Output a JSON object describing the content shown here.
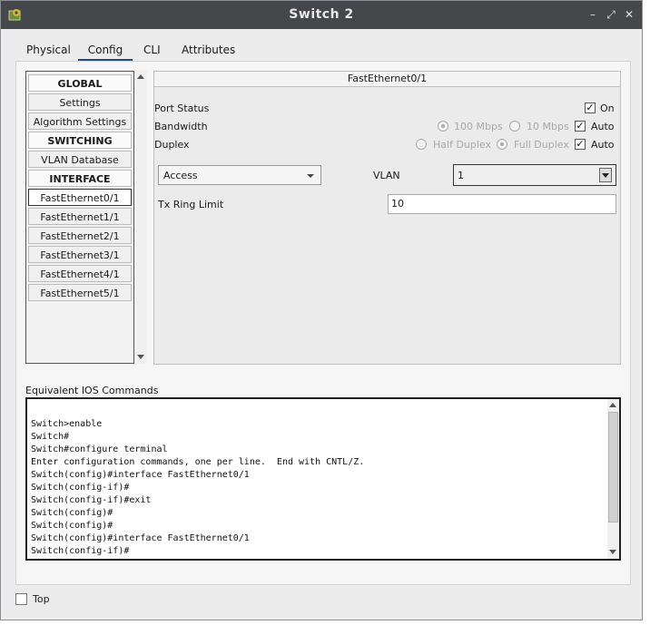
{
  "window": {
    "title": "Switch 2"
  },
  "tabs": [
    {
      "label": "Physical"
    },
    {
      "label": "Config"
    },
    {
      "label": "CLI"
    },
    {
      "label": "Attributes"
    }
  ],
  "sidebar": {
    "items": [
      {
        "label": "GLOBAL"
      },
      {
        "label": "Settings"
      },
      {
        "label": "Algorithm Settings"
      },
      {
        "label": "SWITCHING"
      },
      {
        "label": "VLAN Database"
      },
      {
        "label": "INTERFACE"
      },
      {
        "label": "FastEthernet0/1"
      },
      {
        "label": "FastEthernet1/1"
      },
      {
        "label": "FastEthernet2/1"
      },
      {
        "label": "FastEthernet3/1"
      },
      {
        "label": "FastEthernet4/1"
      },
      {
        "label": "FastEthernet5/1"
      }
    ]
  },
  "interface": {
    "name": "FastEthernet0/1",
    "port_status_label": "Port Status",
    "port_on_label": "On",
    "bandwidth_label": "Bandwidth",
    "bw_100": "100 Mbps",
    "bw_10": "10 Mbps",
    "bw_auto": "Auto",
    "duplex_label": "Duplex",
    "half_duplex": "Half Duplex",
    "full_duplex": "Full Duplex",
    "duplex_auto": "Auto",
    "mode_value": "Access",
    "vlan_label": "VLAN",
    "vlan_value": "1",
    "tx_ring_label": "Tx Ring Limit",
    "tx_ring_value": "10"
  },
  "ios": {
    "label": "Equivalent IOS Commands",
    "text": "Switch>enable\nSwitch#\nSwitch#configure terminal\nEnter configuration commands, one per line.  End with CNTL/Z.\nSwitch(config)#interface FastEthernet0/1\nSwitch(config-if)#\nSwitch(config-if)#exit\nSwitch(config)#\nSwitch(config)#\nSwitch(config)#interface FastEthernet0/1\nSwitch(config-if)#"
  },
  "footer": {
    "top_label": "Top"
  }
}
